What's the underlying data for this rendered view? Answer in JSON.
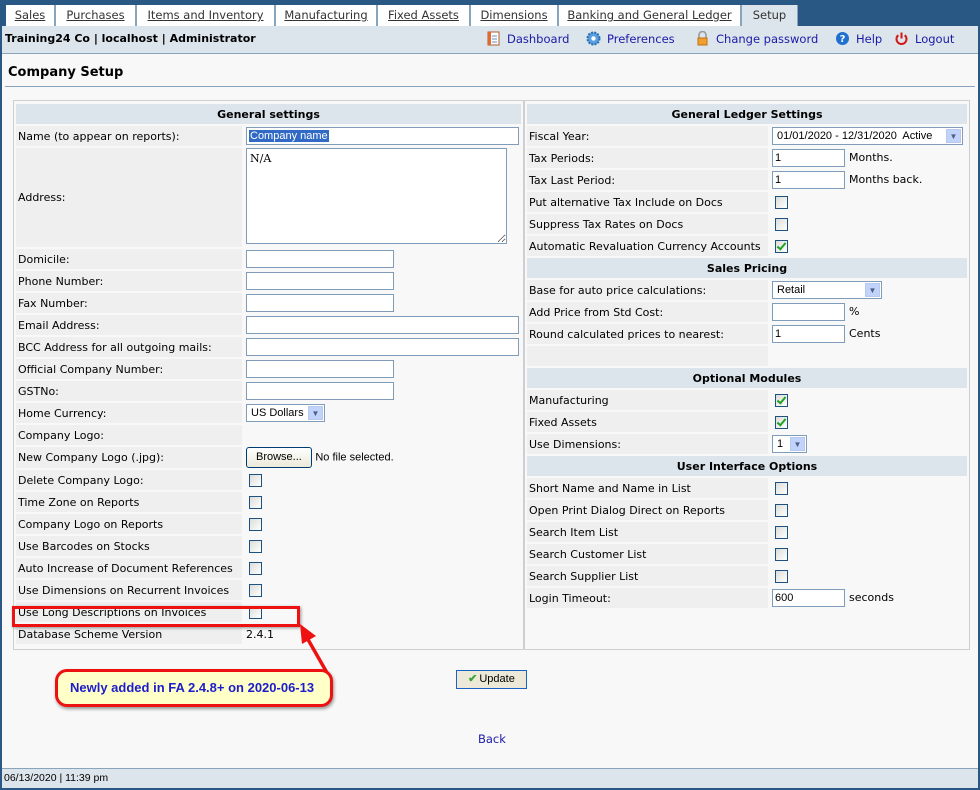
{
  "tabs": [
    {
      "label": "Sales",
      "accesskey": "S",
      "active": false
    },
    {
      "label": "Purchases",
      "accesskey": "P",
      "active": false
    },
    {
      "label": "Items and Inventory",
      "accesskey": "I",
      "active": false
    },
    {
      "label": "Manufacturing",
      "accesskey": "M",
      "active": false
    },
    {
      "label": "Fixed Assets",
      "accesskey": "F",
      "active": false
    },
    {
      "label": "Dimensions",
      "accesskey": "D",
      "active": false
    },
    {
      "label": "Banking and General Ledger",
      "accesskey": "B",
      "active": false
    },
    {
      "label": "Setup",
      "accesskey": "e",
      "active": true
    }
  ],
  "header": {
    "company_info": "Training24 Co | localhost | Administrator",
    "links": {
      "dashboard": {
        "label": "Dashboard",
        "icon": "dashboard-icon"
      },
      "preferences": {
        "label": "Preferences",
        "icon": "gear-icon"
      },
      "change_password": {
        "label": "Change password",
        "icon": "lock-icon"
      },
      "help": {
        "label": "Help",
        "icon": "help-icon"
      },
      "logout": {
        "label": "Logout",
        "icon": "power-icon"
      }
    }
  },
  "page_title": "Company Setup",
  "general": {
    "heading": "General settings",
    "name_label": "Name (to appear on reports):",
    "name_value": "Company name",
    "address_label": "Address:",
    "address_value": "N/A",
    "domicile_label": "Domicile:",
    "phone_label": "Phone Number:",
    "fax_label": "Fax Number:",
    "email_label": "Email Address:",
    "bcc_label": "BCC Address for all outgoing mails:",
    "official_label": "Official Company Number:",
    "gst_label": "GSTNo:",
    "currency_label": "Home Currency:",
    "currency_value": "US Dollars",
    "logo_label": "Company Logo:",
    "new_logo_label": "New Company Logo (.jpg):",
    "browse_label": "Browse...",
    "no_file": "No file selected.",
    "checkboxes": [
      {
        "label": "Delete Company Logo:",
        "checked": false
      },
      {
        "label": "Time Zone on Reports",
        "checked": false
      },
      {
        "label": "Company Logo on Reports",
        "checked": false
      },
      {
        "label": "Use Barcodes on Stocks",
        "checked": false
      },
      {
        "label": "Auto Increase of Document References",
        "checked": false
      },
      {
        "label": "Use Dimensions on Recurrent Invoices",
        "checked": false
      },
      {
        "label": "Use Long Descriptions on Invoices",
        "checked": false
      }
    ],
    "db_version_label": "Database Scheme Version",
    "db_version_value": "2.4.1"
  },
  "gl": {
    "heading": "General Ledger Settings",
    "fiscal_label": "Fiscal Year:",
    "fiscal_value": "01/01/2020 - 12/31/2020  Active",
    "tax_periods_label": "Tax Periods:",
    "tax_periods_value": "1",
    "tax_periods_suffix": "Months.",
    "tax_last_label": "Tax Last Period:",
    "tax_last_value": "1",
    "tax_last_suffix": "Months back.",
    "checkboxes": [
      {
        "label": "Put alternative Tax Include on Docs",
        "checked": false
      },
      {
        "label": "Suppress Tax Rates on Docs",
        "checked": false
      },
      {
        "label": "Automatic Revaluation Currency Accounts",
        "checked": true
      }
    ]
  },
  "sales_pricing": {
    "heading": "Sales Pricing",
    "base_label": "Base for auto price calculations:",
    "base_value": "Retail",
    "add_price_label": "Add Price from Std Cost:",
    "add_price_value": "",
    "add_price_suffix": "%",
    "round_label": "Round calculated prices to nearest:",
    "round_value": "1",
    "round_suffix": "Cents"
  },
  "optional_modules": {
    "heading": "Optional Modules",
    "manufacturing_label": "Manufacturing",
    "manufacturing_checked": true,
    "fixed_assets_label": "Fixed Assets",
    "fixed_assets_checked": true,
    "dimensions_label": "Use Dimensions:",
    "dimensions_value": "1"
  },
  "ui_options": {
    "heading": "User Interface Options",
    "checkboxes": [
      {
        "label": "Short Name and Name in List",
        "checked": false
      },
      {
        "label": "Open Print Dialog Direct on Reports",
        "checked": false
      },
      {
        "label": "Search Item List",
        "checked": false
      },
      {
        "label": "Search Customer List",
        "checked": false
      },
      {
        "label": "Search Supplier List",
        "checked": false
      }
    ],
    "timeout_label": "Login Timeout:",
    "timeout_value": "600",
    "timeout_suffix": "seconds"
  },
  "actions": {
    "update_label": "Update",
    "back_label": "Back"
  },
  "annotation": {
    "callout_text": "Newly added in FA 2.4.8+ on 2020-06-13",
    "color": "#ee1111"
  },
  "footer": {
    "datetime": "06/13/2020 | 11:39 pm"
  },
  "colors": {
    "frame": "#2a5885",
    "header_bg": "#dde5ec",
    "link": "#1a1aa6",
    "check": "#21a121"
  }
}
